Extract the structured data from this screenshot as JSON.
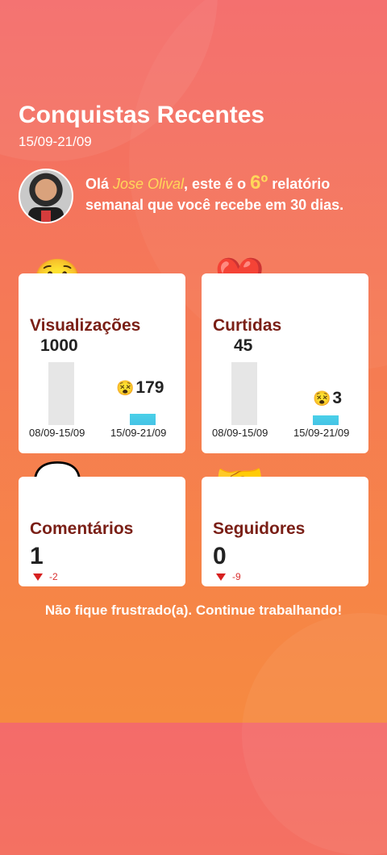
{
  "header": {
    "title": "Conquistas Recentes",
    "date_range": "15/09-21/09"
  },
  "greeting": {
    "prefix": "Olá ",
    "name": "Jose Olival",
    "middle": ", este é o ",
    "number": "6º",
    "suffix": " relatório semanal que você recebe em 30 dias."
  },
  "cards": {
    "views": {
      "emoji": "😲",
      "label": "Visualizações",
      "prev_value": "1000",
      "cur_emoji": "😵",
      "cur_value": "179",
      "prev_period": "08/09-15/09",
      "cur_period": "15/09-21/09",
      "prev_num": 1000,
      "cur_num": 179
    },
    "likes": {
      "emoji": "❤️",
      "label": "Curtidas",
      "prev_value": "45",
      "cur_emoji": "😵",
      "cur_value": "3",
      "prev_period": "08/09-15/09",
      "cur_period": "15/09-21/09",
      "prev_num": 45,
      "cur_num": 3
    },
    "comments": {
      "emoji": "💬",
      "label": "Comentários",
      "count": "1",
      "delta": "-2"
    },
    "followers": {
      "emoji": "🤝",
      "label": "Seguidores",
      "count": "0",
      "delta": "-9"
    }
  },
  "footer": {
    "message": "Não fique frustrado(a). Continue trabalhando!"
  },
  "colors": {
    "accent_name": "#ffd75a",
    "label": "#7a1f16",
    "bar_current": "#4ad0e8",
    "bar_previous": "#e6e6e6",
    "decrease": "#d62020"
  }
}
